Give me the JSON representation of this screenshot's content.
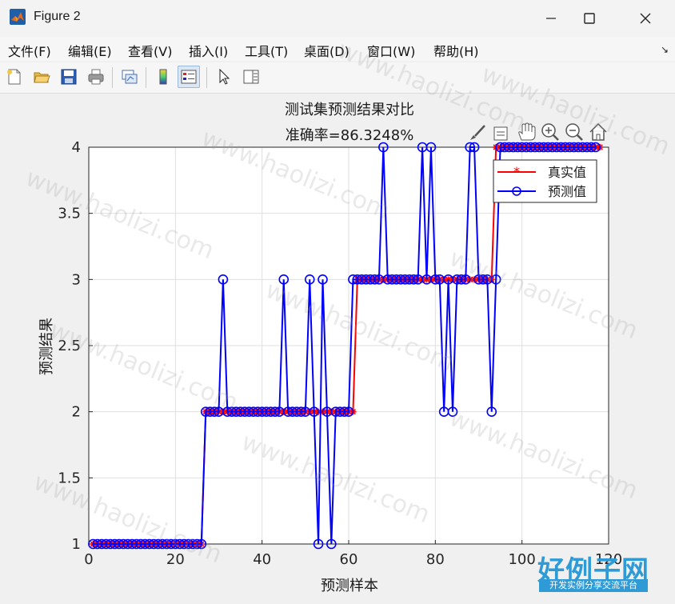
{
  "window": {
    "title": "Figure 2"
  },
  "menu": [
    "文件(F)",
    "编辑(E)",
    "查看(V)",
    "插入(I)",
    "工具(T)",
    "桌面(D)",
    "窗口(W)",
    "帮助(H)"
  ],
  "toolbar_icons": [
    "new-figure-icon",
    "open-file-icon",
    "save-icon",
    "print-icon",
    "link-plot-icon",
    "colorbar-icon",
    "legend-icon",
    "pointer-icon",
    "property-editor-icon"
  ],
  "axes_toolbar_icons": [
    "brush-icon",
    "data-tip-icon",
    "pan-icon",
    "zoom-in-icon",
    "zoom-out-icon",
    "home-icon"
  ],
  "watermark": "www.haolizi.com",
  "logo": {
    "main": "好例子网",
    "sub": "开发实例分享交流平台"
  },
  "colors": {
    "true_series": "#ff0000",
    "pred_series": "#0000ff",
    "grid": "#dfdfdf"
  },
  "chart_data": {
    "type": "line",
    "title": "测试集预测结果对比",
    "subtitle": "准确率=86.3248%",
    "xlabel": "预测样本",
    "ylabel": "预测结果",
    "xlim": [
      0,
      120
    ],
    "ylim": [
      1,
      4
    ],
    "xticks": [
      0,
      20,
      40,
      60,
      80,
      100,
      120
    ],
    "yticks": [
      1,
      1.5,
      2,
      2.5,
      3,
      3.5,
      4
    ],
    "grid": true,
    "legend_position": "top-right",
    "series": [
      {
        "name": "真实值",
        "marker": "*",
        "color": "#ff0000",
        "values": [
          1,
          1,
          1,
          1,
          1,
          1,
          1,
          1,
          1,
          1,
          1,
          1,
          1,
          1,
          1,
          1,
          1,
          1,
          1,
          1,
          1,
          1,
          1,
          1,
          1,
          1,
          2,
          2,
          2,
          2,
          2,
          2,
          2,
          2,
          2,
          2,
          2,
          2,
          2,
          2,
          2,
          2,
          2,
          2,
          2,
          2,
          2,
          2,
          2,
          2,
          2,
          2,
          2,
          2,
          2,
          2,
          2,
          2,
          2,
          2,
          2,
          3,
          3,
          3,
          3,
          3,
          3,
          3,
          3,
          3,
          3,
          3,
          3,
          3,
          3,
          3,
          3,
          3,
          3,
          3,
          3,
          3,
          3,
          3,
          3,
          3,
          3,
          3,
          3,
          3,
          3,
          3,
          3,
          4,
          4,
          4,
          4,
          4,
          4,
          4,
          4,
          4,
          4,
          4,
          4,
          4,
          4,
          4,
          4,
          4,
          4,
          4,
          4,
          4,
          4,
          4,
          4,
          4
        ]
      },
      {
        "name": "预测值",
        "marker": "o",
        "color": "#0000ff",
        "values": [
          1,
          1,
          1,
          1,
          1,
          1,
          1,
          1,
          1,
          1,
          1,
          1,
          1,
          1,
          1,
          1,
          1,
          1,
          1,
          1,
          1,
          1,
          1,
          1,
          1,
          1,
          2,
          2,
          2,
          2,
          3,
          2,
          2,
          2,
          2,
          2,
          2,
          2,
          2,
          2,
          2,
          2,
          2,
          2,
          3,
          2,
          2,
          2,
          2,
          2,
          3,
          2,
          1,
          3,
          2,
          1,
          2,
          2,
          2,
          2,
          3,
          3,
          3,
          3,
          3,
          3,
          3,
          4,
          3,
          3,
          3,
          3,
          3,
          3,
          3,
          3,
          4,
          3,
          4,
          3,
          3,
          2,
          3,
          2,
          3,
          3,
          3,
          4,
          4,
          3,
          3,
          3,
          2,
          3,
          4,
          4,
          4,
          4,
          4,
          4,
          4,
          4,
          4,
          4,
          4,
          4,
          4,
          4,
          4,
          4,
          4,
          4,
          4,
          4,
          4,
          4,
          4
        ]
      }
    ]
  }
}
